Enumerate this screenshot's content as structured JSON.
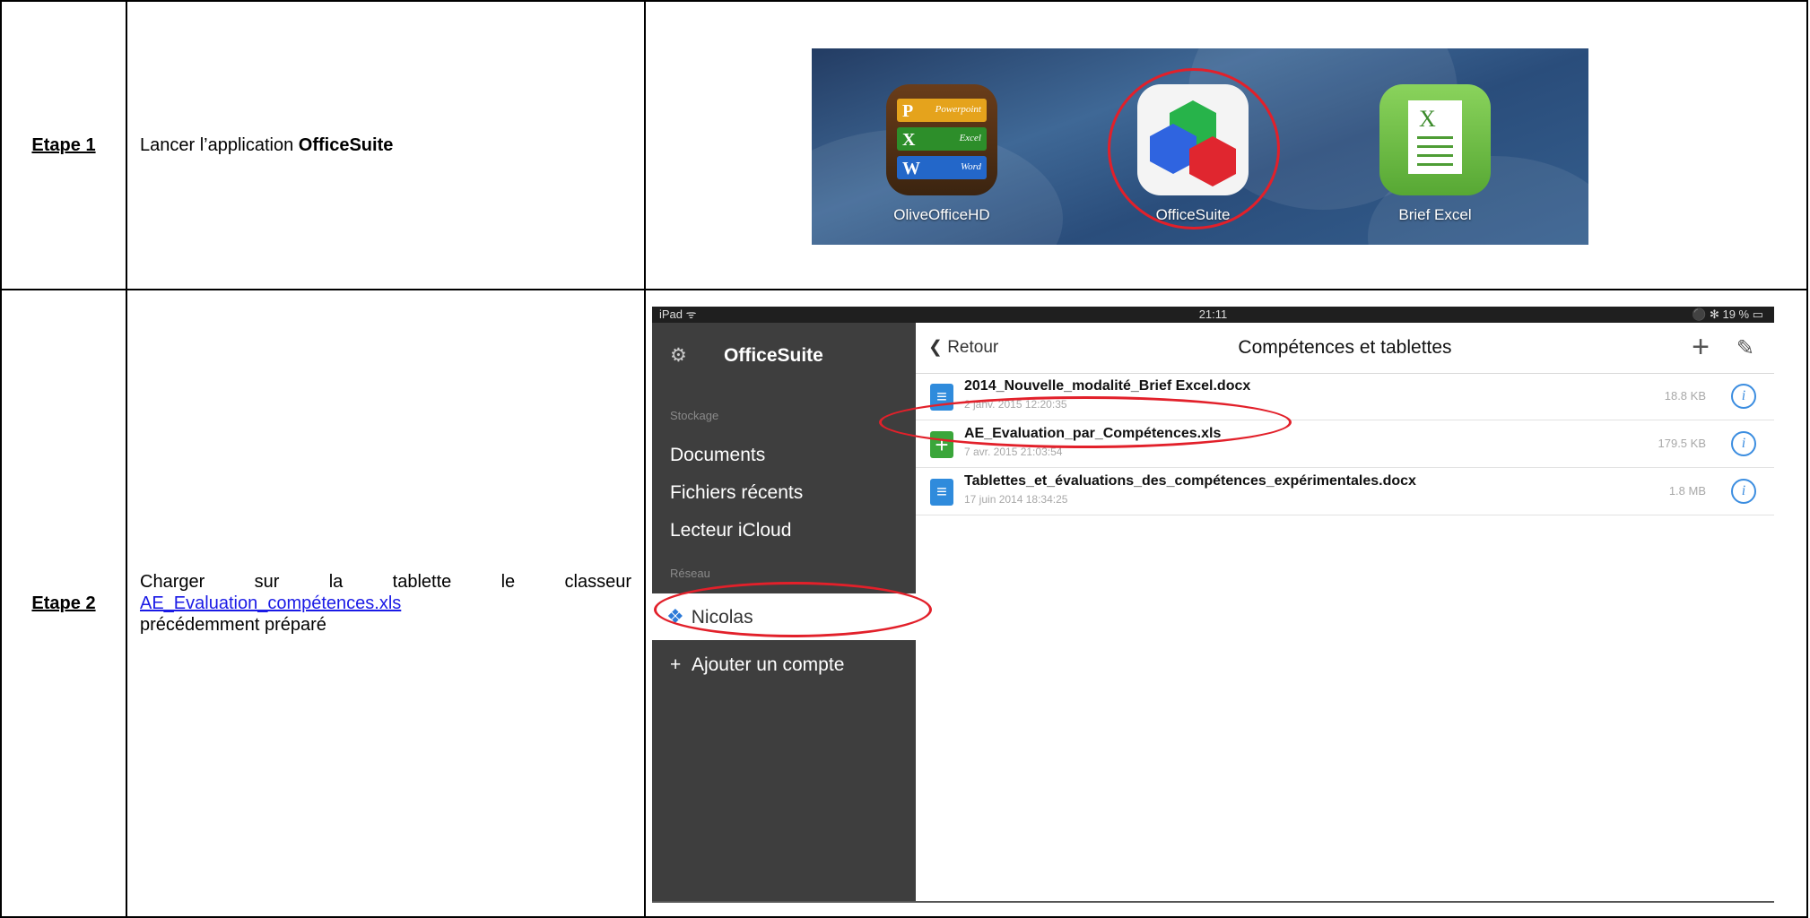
{
  "table": {
    "step1": {
      "label": "Etape 1",
      "text_before": "Lancer l’application ",
      "text_bold": "OfficeSuite"
    },
    "step2": {
      "label": "Etape 2",
      "line1": "Charger sur la tablette le classeur",
      "link": "AE_Evaluation_compétences.xls",
      "line3": "précédemment préparé"
    }
  },
  "home_screen": {
    "apps": [
      {
        "label": "OliveOfficeHD",
        "icon": "olive-office-icon"
      },
      {
        "label": "OfficeSuite",
        "icon": "officesuite-icon",
        "highlighted": true
      },
      {
        "label": "Brief Excel",
        "icon": "brief-excel-icon"
      }
    ],
    "olive_bars": [
      {
        "letter": "P",
        "word": "Powerpoint"
      },
      {
        "letter": "X",
        "word": "Excel"
      },
      {
        "letter": "W",
        "word": "Word"
      }
    ]
  },
  "ipad": {
    "status": {
      "left": "iPad ᯤ",
      "time": "21:11",
      "battery": "⚫ ✻ 19 % ▭"
    },
    "sidebar": {
      "app_title": "OfficeSuite",
      "storage_label": "Stockage",
      "items": [
        "Documents",
        "Fichiers récents",
        "Lecteur iCloud"
      ],
      "network_label": "Réseau",
      "account": "Nicolas",
      "add_account": "Ajouter un compte"
    },
    "nav": {
      "back": "Retour",
      "title": "Compétences et tablettes"
    },
    "files": [
      {
        "name": "2014_Nouvelle_modalité_Brief Excel.docx",
        "date": "2 janv. 2015 12:20:35",
        "size": "18.8 KB",
        "type": "docx"
      },
      {
        "name": "AE_Evaluation_par_Compétences.xls",
        "date": "7 avr. 2015 21:03:54",
        "size": "179.5 KB",
        "type": "xls",
        "highlighted": true
      },
      {
        "name": "Tablettes_et_évaluations_des_compétences_expérimentales.docx",
        "date": "17 juin 2014 18:34:25",
        "size": "1.8 MB",
        "type": "docx"
      }
    ]
  },
  "colors": {
    "highlight_ring": "#e2202a",
    "link": "#1a1ae6",
    "sidebar_bg": "#3e3e3e",
    "doc_icon": "#2f8bdc",
    "xls_icon": "#3aa63a",
    "info": "#3b8de0"
  }
}
